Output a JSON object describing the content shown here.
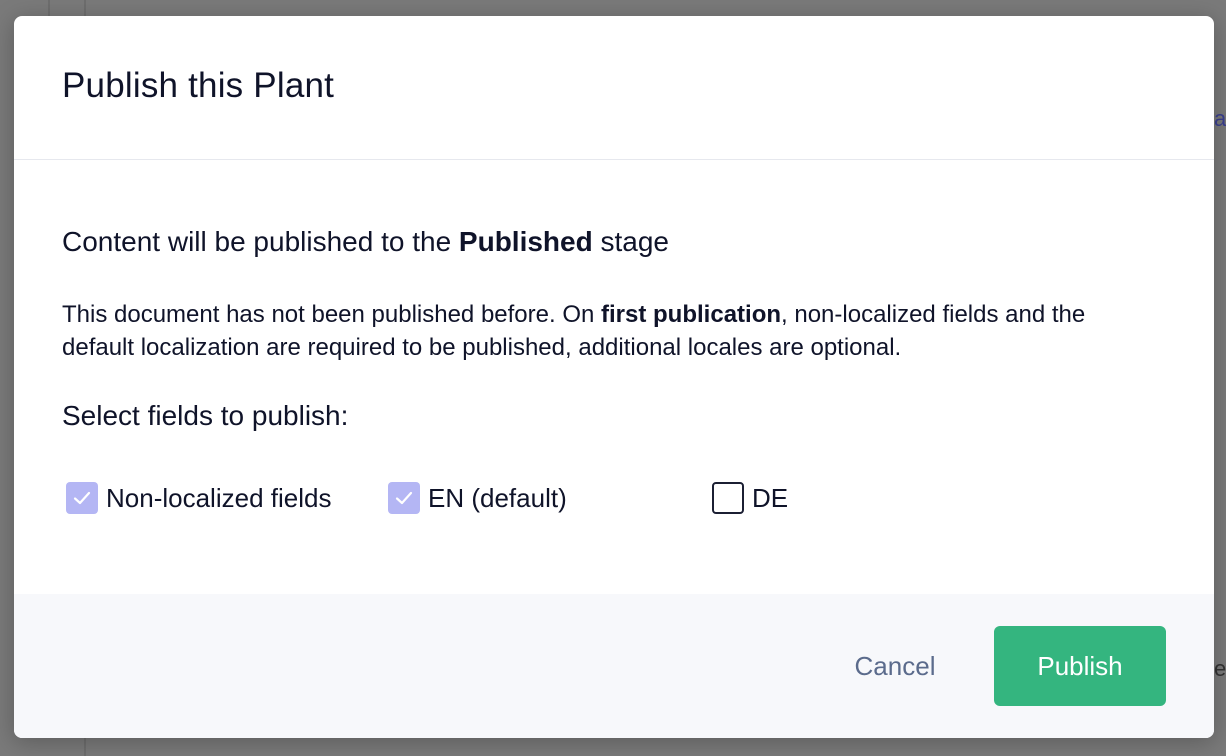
{
  "modal": {
    "title": "Publish this Plant",
    "stage_prefix": "Content will be published to the ",
    "stage_name": "Published",
    "stage_suffix": " stage",
    "note_prefix": "This document has not been published before. On ",
    "note_bold": "first publication",
    "note_suffix": ", non-localized fields and the default localization are required to be published, additional locales are optional.",
    "select_label": "Select fields to publish:",
    "fields": [
      {
        "label": "Non-localized fields",
        "checked": true
      },
      {
        "label": "EN (default)",
        "checked": true
      },
      {
        "label": "DE",
        "checked": false
      }
    ],
    "cancel_label": "Cancel",
    "publish_label": "Publish"
  },
  "background": {
    "right_text_top": "a",
    "right_text_bottom": "ed"
  },
  "colors": {
    "checkbox_checked": "#b4b6f4",
    "publish_button": "#34b57f",
    "cancel_text": "#5b6b8c",
    "footer_bg": "#f7f8fb"
  }
}
